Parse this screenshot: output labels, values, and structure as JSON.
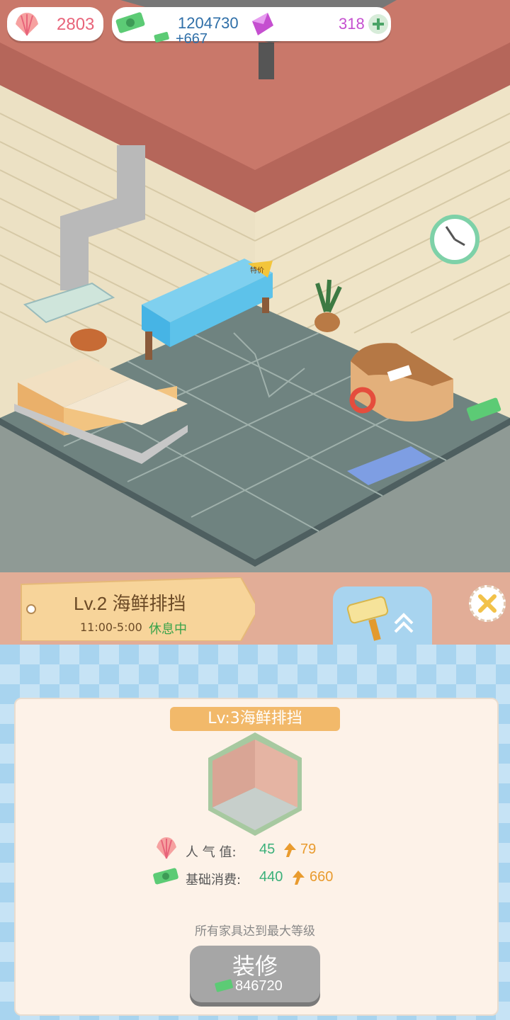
{
  "hud": {
    "shells": "2803",
    "cash": "1204730",
    "cash_rate": "+667",
    "gems": "318"
  },
  "restaurant": {
    "current_level": "Lv.2",
    "current_name": "海鲜排挡",
    "hours": "11:00-5:00",
    "status": "休息中",
    "sale_badge": "特价"
  },
  "upgrade": {
    "next_title": "Lv:3海鲜排挡",
    "popularity_label": "人 气 值:",
    "popularity_current": "45",
    "popularity_next": "79",
    "base_spend_label": "基础消费:",
    "base_spend_current": "440",
    "base_spend_next": "660",
    "max_note": "所有家具达到最大等级",
    "button_label": "装修",
    "button_cost": "846720"
  },
  "colors": {
    "green_value": "#3bb07a",
    "orange_value": "#e99b2e",
    "shell_pink": "#e8647a",
    "gem_purple": "#c54fd0"
  }
}
